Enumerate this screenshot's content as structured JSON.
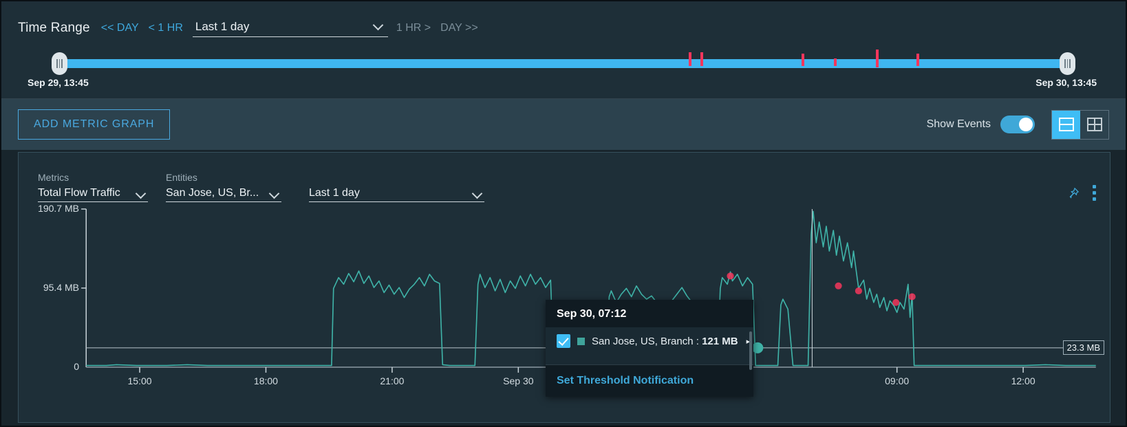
{
  "time_range": {
    "title": "Time Range",
    "nav_prev_day": "<< DAY",
    "nav_prev_hour": "< 1 HR",
    "selected": "Last 1 day",
    "nav_next_hour": "1 HR >",
    "nav_next_day": "DAY >>",
    "start_label": "Sep 29, 13:45",
    "end_label": "Sep 30, 13:45",
    "event_ticks": [
      {
        "pos": 62.4,
        "height": 20,
        "top": 6
      },
      {
        "pos": 63.6,
        "height": 20,
        "top": 6
      },
      {
        "pos": 73.6,
        "height": 18,
        "top": 8
      },
      {
        "pos": 76.8,
        "height": 11,
        "top": 15
      },
      {
        "pos": 81.0,
        "height": 26,
        "top": 2
      },
      {
        "pos": 85.0,
        "height": 18,
        "top": 8
      }
    ]
  },
  "toolbar": {
    "add_metric_graph": "ADD METRIC GRAPH",
    "show_events_label": "Show Events",
    "show_events_on": true,
    "layout_split_icon": "split-layout-icon",
    "layout_grid_icon": "grid-layout-icon",
    "accent": "#3fbdf5"
  },
  "graph_card": {
    "metrics_label": "Metrics",
    "metrics_value": "Total Flow Traffic",
    "entities_label": "Entities",
    "entities_value": "San Jose, US, Br...",
    "range_value": "Last 1 day",
    "pin_icon": "pin-icon",
    "menu_icon": "more-vertical-icon"
  },
  "chart_data": {
    "type": "line",
    "title": "Total Flow Traffic",
    "xlabel": "",
    "ylabel": "",
    "series_name": "San Jose, US, Branch",
    "series_color": "#3fb3a8",
    "grid": false,
    "legend": "none",
    "ylim": [
      0,
      190.7
    ],
    "y_unit": "MB",
    "y_ticks": [
      {
        "value": 190.7,
        "label": "190.7 MB"
      },
      {
        "value": 95.4,
        "label": "95.4 MB"
      },
      {
        "value": 23.3,
        "label": "23.3 MB"
      },
      {
        "value": 0,
        "label": "0"
      }
    ],
    "threshold": {
      "value": 23.3,
      "label": "23.3 MB"
    },
    "x_ticks": [
      "15:00",
      "18:00",
      "21:00",
      "Sep 30",
      "09:00",
      "12:00"
    ],
    "x_tick_pos": [
      5.3,
      17.8,
      30.3,
      42.8,
      80.3,
      92.8
    ],
    "x_range": [
      "Sep 29, 13:45",
      "Sep 30, 13:45"
    ],
    "anomaly_color": "#f5365c",
    "anomaly_points": [
      {
        "x": 63.8,
        "y": 110
      },
      {
        "x": 74.5,
        "y": 98
      },
      {
        "x": 76.5,
        "y": 92
      },
      {
        "x": 80.2,
        "y": 78
      },
      {
        "x": 81.8,
        "y": 85
      }
    ],
    "points": [
      [
        0,
        2
      ],
      [
        2,
        2
      ],
      [
        3,
        3
      ],
      [
        5,
        2
      ],
      [
        6,
        2
      ],
      [
        8,
        2
      ],
      [
        10,
        3
      ],
      [
        12,
        2
      ],
      [
        14,
        2
      ],
      [
        16,
        2
      ],
      [
        18,
        2
      ],
      [
        20,
        2
      ],
      [
        22,
        2
      ],
      [
        24,
        2
      ],
      [
        24.3,
        2
      ],
      [
        24.5,
        95
      ],
      [
        25,
        108
      ],
      [
        25.5,
        100
      ],
      [
        26,
        113
      ],
      [
        26.5,
        103
      ],
      [
        27,
        116
      ],
      [
        27.5,
        101
      ],
      [
        28,
        110
      ],
      [
        28.5,
        96
      ],
      [
        29,
        104
      ],
      [
        29.5,
        90
      ],
      [
        30,
        99
      ],
      [
        30.5,
        88
      ],
      [
        31,
        96
      ],
      [
        31.5,
        84
      ],
      [
        32,
        94
      ],
      [
        32.5,
        100
      ],
      [
        33,
        108
      ],
      [
        33.5,
        98
      ],
      [
        34,
        112
      ],
      [
        34.5,
        104
      ],
      [
        35,
        101
      ],
      [
        35.3,
        3
      ],
      [
        36,
        2
      ],
      [
        37,
        2
      ],
      [
        38,
        2
      ],
      [
        38.5,
        2
      ],
      [
        38.8,
        100
      ],
      [
        39,
        112
      ],
      [
        39.5,
        96
      ],
      [
        40,
        108
      ],
      [
        40.5,
        92
      ],
      [
        41,
        106
      ],
      [
        41.5,
        90
      ],
      [
        42,
        104
      ],
      [
        42.5,
        95
      ],
      [
        43,
        110
      ],
      [
        43.5,
        98
      ],
      [
        44,
        112
      ],
      [
        44.5,
        100
      ],
      [
        45,
        108
      ],
      [
        45.5,
        96
      ],
      [
        46,
        105
      ],
      [
        46.3,
        2
      ],
      [
        47,
        2
      ],
      [
        48,
        2
      ],
      [
        49,
        2
      ],
      [
        50,
        2
      ],
      [
        51,
        2
      ],
      [
        51.5,
        2
      ],
      [
        51.8,
        85
      ],
      [
        52,
        92
      ],
      [
        52.5,
        78
      ],
      [
        53,
        88
      ],
      [
        53.5,
        95
      ],
      [
        54,
        85
      ],
      [
        54.5,
        98
      ],
      [
        55,
        88
      ],
      [
        55.5,
        82
      ],
      [
        56,
        86
      ],
      [
        56.5,
        78
      ],
      [
        57,
        72
      ],
      [
        57.5,
        68
      ],
      [
        58,
        80
      ],
      [
        58.5,
        88
      ],
      [
        59,
        96
      ],
      [
        59.5,
        86
      ],
      [
        60,
        78
      ],
      [
        60.3,
        2
      ],
      [
        61,
        2
      ],
      [
        62,
        2
      ],
      [
        62.5,
        2
      ],
      [
        62.8,
        95
      ],
      [
        63,
        108
      ],
      [
        63.5,
        100
      ],
      [
        63.8,
        115
      ],
      [
        64,
        104
      ],
      [
        64.5,
        112
      ],
      [
        65,
        98
      ],
      [
        65.5,
        108
      ],
      [
        66,
        100
      ],
      [
        66.3,
        2
      ],
      [
        67,
        2
      ],
      [
        68,
        2
      ],
      [
        68.5,
        2
      ],
      [
        68.8,
        75
      ],
      [
        69,
        82
      ],
      [
        69.5,
        70
      ],
      [
        70,
        2
      ],
      [
        71,
        2
      ],
      [
        71.5,
        2
      ],
      [
        71.8,
        160
      ],
      [
        72,
        188
      ],
      [
        72.3,
        150
      ],
      [
        72.6,
        175
      ],
      [
        73,
        145
      ],
      [
        73.3,
        170
      ],
      [
        73.6,
        140
      ],
      [
        74,
        165
      ],
      [
        74.3,
        135
      ],
      [
        74.6,
        158
      ],
      [
        75,
        128
      ],
      [
        75.4,
        150
      ],
      [
        75.8,
        120
      ],
      [
        76,
        140
      ],
      [
        76.5,
        95
      ],
      [
        77,
        105
      ],
      [
        77.3,
        82
      ],
      [
        77.6,
        95
      ],
      [
        78,
        78
      ],
      [
        78.3,
        88
      ],
      [
        78.6,
        72
      ],
      [
        79,
        84
      ],
      [
        79.3,
        68
      ],
      [
        79.6,
        80
      ],
      [
        80,
        74
      ],
      [
        80.3,
        66
      ],
      [
        80.6,
        78
      ],
      [
        81,
        70
      ],
      [
        81.4,
        100
      ],
      [
        81.6,
        60
      ],
      [
        81.8,
        88
      ],
      [
        82,
        2
      ],
      [
        83,
        2
      ],
      [
        85,
        2
      ],
      [
        87,
        2
      ],
      [
        89,
        2
      ],
      [
        91,
        2
      ],
      [
        93,
        2
      ],
      [
        95,
        3
      ],
      [
        97,
        2
      ],
      [
        99,
        2
      ],
      [
        100,
        2
      ]
    ]
  },
  "tooltip": {
    "timestamp": "Sep 30, 07:12",
    "checked": true,
    "series_swatch_color": "#3fa39b",
    "entity": "San Jose, US, Branch",
    "separator": " : ",
    "value": "121 MB",
    "expand_arrow": "▸",
    "link": "Set Threshold Notification"
  }
}
